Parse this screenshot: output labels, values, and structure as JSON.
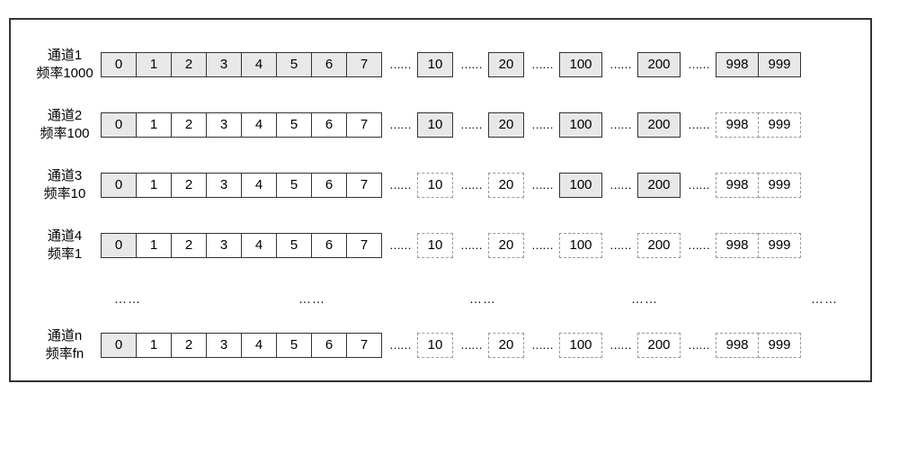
{
  "colDots": "……",
  "vdots": "⋮",
  "channels": [
    {
      "label1": "通道1",
      "label2": "频率1000",
      "cells": [
        {
          "v": "0",
          "shaded": true,
          "dashed": false,
          "wide": false
        },
        {
          "v": "1",
          "shaded": true,
          "dashed": false,
          "wide": false
        },
        {
          "v": "2",
          "shaded": true,
          "dashed": false,
          "wide": false
        },
        {
          "v": "3",
          "shaded": true,
          "dashed": false,
          "wide": false
        },
        {
          "v": "4",
          "shaded": true,
          "dashed": false,
          "wide": false
        },
        {
          "v": "5",
          "shaded": true,
          "dashed": false,
          "wide": false
        },
        {
          "v": "6",
          "shaded": true,
          "dashed": false,
          "wide": false
        },
        {
          "v": "7",
          "shaded": true,
          "dashed": false,
          "wide": false
        },
        "dots",
        {
          "v": "10",
          "shaded": true,
          "dashed": false,
          "wide": false
        },
        "dots",
        {
          "v": "20",
          "shaded": true,
          "dashed": false,
          "wide": false
        },
        "dots",
        {
          "v": "100",
          "shaded": true,
          "dashed": false,
          "wide": true
        },
        "dots",
        {
          "v": "200",
          "shaded": true,
          "dashed": false,
          "wide": true
        },
        "dots",
        {
          "v": "998",
          "shaded": true,
          "dashed": false,
          "wide": true
        },
        {
          "v": "999",
          "shaded": true,
          "dashed": false,
          "wide": true
        }
      ]
    },
    {
      "label1": "通道2",
      "label2": "频率100",
      "cells": [
        {
          "v": "0",
          "shaded": true,
          "dashed": false,
          "wide": false
        },
        {
          "v": "1",
          "shaded": false,
          "dashed": false,
          "wide": false
        },
        {
          "v": "2",
          "shaded": false,
          "dashed": false,
          "wide": false
        },
        {
          "v": "3",
          "shaded": false,
          "dashed": false,
          "wide": false
        },
        {
          "v": "4",
          "shaded": false,
          "dashed": false,
          "wide": false
        },
        {
          "v": "5",
          "shaded": false,
          "dashed": false,
          "wide": false
        },
        {
          "v": "6",
          "shaded": false,
          "dashed": false,
          "wide": false
        },
        {
          "v": "7",
          "shaded": false,
          "dashed": false,
          "wide": false
        },
        "dots",
        {
          "v": "10",
          "shaded": true,
          "dashed": false,
          "wide": false
        },
        "dots",
        {
          "v": "20",
          "shaded": true,
          "dashed": false,
          "wide": false
        },
        "dots",
        {
          "v": "100",
          "shaded": true,
          "dashed": false,
          "wide": true
        },
        "dots",
        {
          "v": "200",
          "shaded": true,
          "dashed": false,
          "wide": true
        },
        "dots",
        {
          "v": "998",
          "shaded": false,
          "dashed": true,
          "wide": true
        },
        {
          "v": "999",
          "shaded": false,
          "dashed": true,
          "wide": true
        }
      ]
    },
    {
      "label1": "通道3",
      "label2": "频率10",
      "cells": [
        {
          "v": "0",
          "shaded": true,
          "dashed": false,
          "wide": false
        },
        {
          "v": "1",
          "shaded": false,
          "dashed": false,
          "wide": false
        },
        {
          "v": "2",
          "shaded": false,
          "dashed": false,
          "wide": false
        },
        {
          "v": "3",
          "shaded": false,
          "dashed": false,
          "wide": false
        },
        {
          "v": "4",
          "shaded": false,
          "dashed": false,
          "wide": false
        },
        {
          "v": "5",
          "shaded": false,
          "dashed": false,
          "wide": false
        },
        {
          "v": "6",
          "shaded": false,
          "dashed": false,
          "wide": false
        },
        {
          "v": "7",
          "shaded": false,
          "dashed": false,
          "wide": false
        },
        "dots",
        {
          "v": "10",
          "shaded": false,
          "dashed": true,
          "wide": false
        },
        "dots",
        {
          "v": "20",
          "shaded": false,
          "dashed": true,
          "wide": false
        },
        "dots",
        {
          "v": "100",
          "shaded": true,
          "dashed": false,
          "wide": true
        },
        "dots",
        {
          "v": "200",
          "shaded": true,
          "dashed": false,
          "wide": true
        },
        "dots",
        {
          "v": "998",
          "shaded": false,
          "dashed": true,
          "wide": true
        },
        {
          "v": "999",
          "shaded": false,
          "dashed": true,
          "wide": true
        }
      ]
    },
    {
      "label1": "通道4",
      "label2": "频率1",
      "cells": [
        {
          "v": "0",
          "shaded": true,
          "dashed": false,
          "wide": false
        },
        {
          "v": "1",
          "shaded": false,
          "dashed": false,
          "wide": false
        },
        {
          "v": "2",
          "shaded": false,
          "dashed": false,
          "wide": false
        },
        {
          "v": "3",
          "shaded": false,
          "dashed": false,
          "wide": false
        },
        {
          "v": "4",
          "shaded": false,
          "dashed": false,
          "wide": false
        },
        {
          "v": "5",
          "shaded": false,
          "dashed": false,
          "wide": false
        },
        {
          "v": "6",
          "shaded": false,
          "dashed": false,
          "wide": false
        },
        {
          "v": "7",
          "shaded": false,
          "dashed": false,
          "wide": false
        },
        "dots",
        {
          "v": "10",
          "shaded": false,
          "dashed": true,
          "wide": false
        },
        "dots",
        {
          "v": "20",
          "shaded": false,
          "dashed": true,
          "wide": false
        },
        "dots",
        {
          "v": "100",
          "shaded": false,
          "dashed": true,
          "wide": true
        },
        "dots",
        {
          "v": "200",
          "shaded": false,
          "dashed": true,
          "wide": true
        },
        "dots",
        {
          "v": "998",
          "shaded": false,
          "dashed": true,
          "wide": true
        },
        {
          "v": "999",
          "shaded": false,
          "dashed": true,
          "wide": true
        }
      ]
    },
    "vdots",
    {
      "label1": "通道n",
      "label2": "频率fn",
      "cells": [
        {
          "v": "0",
          "shaded": true,
          "dashed": false,
          "wide": false
        },
        {
          "v": "1",
          "shaded": false,
          "dashed": false,
          "wide": false
        },
        {
          "v": "2",
          "shaded": false,
          "dashed": false,
          "wide": false
        },
        {
          "v": "3",
          "shaded": false,
          "dashed": false,
          "wide": false
        },
        {
          "v": "4",
          "shaded": false,
          "dashed": false,
          "wide": false
        },
        {
          "v": "5",
          "shaded": false,
          "dashed": false,
          "wide": false
        },
        {
          "v": "6",
          "shaded": false,
          "dashed": false,
          "wide": false
        },
        {
          "v": "7",
          "shaded": false,
          "dashed": false,
          "wide": false
        },
        "dots",
        {
          "v": "10",
          "shaded": false,
          "dashed": true,
          "wide": false
        },
        "dots",
        {
          "v": "20",
          "shaded": false,
          "dashed": true,
          "wide": false
        },
        "dots",
        {
          "v": "100",
          "shaded": false,
          "dashed": true,
          "wide": true
        },
        "dots",
        {
          "v": "200",
          "shaded": false,
          "dashed": true,
          "wide": true
        },
        "dots",
        {
          "v": "998",
          "shaded": false,
          "dashed": true,
          "wide": true
        },
        {
          "v": "999",
          "shaded": false,
          "dashed": true,
          "wide": true
        }
      ]
    }
  ],
  "vdotsPositions": [
    95,
    300,
    490,
    670,
    870
  ]
}
